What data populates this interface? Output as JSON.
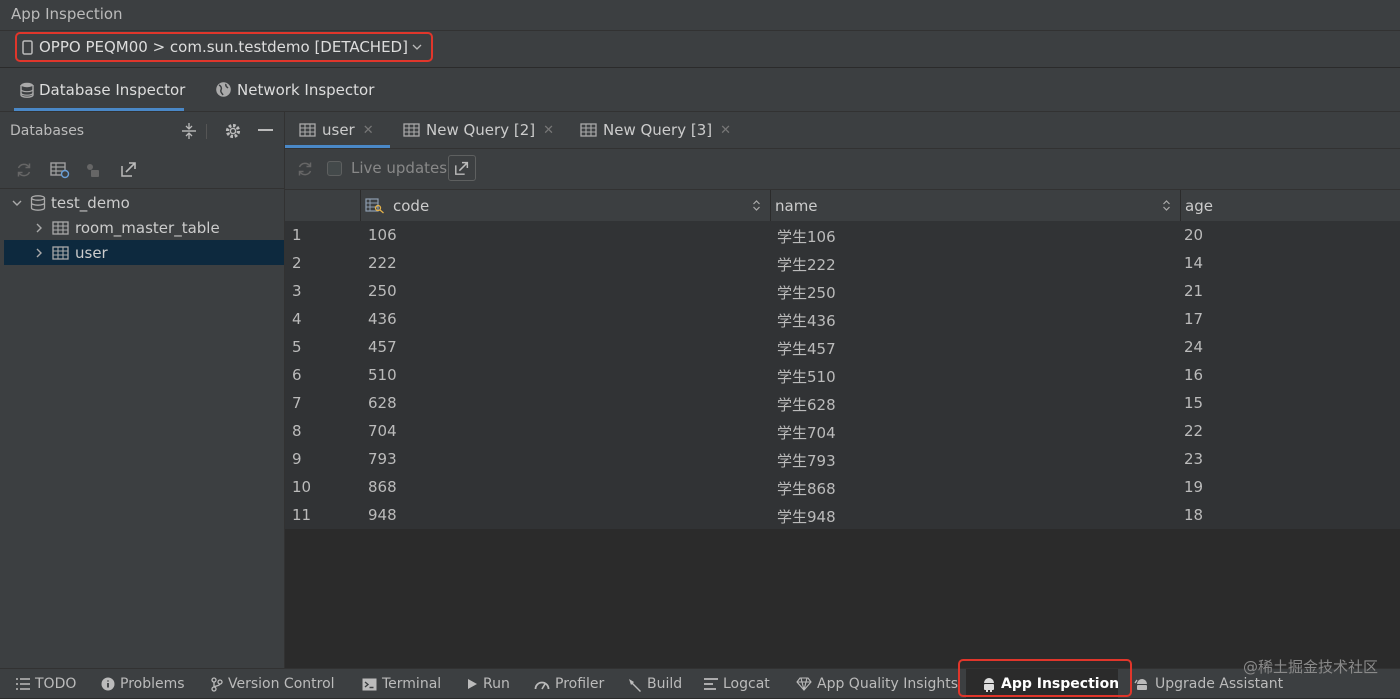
{
  "window": {
    "title": "App Inspection"
  },
  "device": {
    "label": "OPPO PEQM00 > com.sun.testdemo [DETACHED]"
  },
  "inspector_tabs": [
    {
      "label": "Database Inspector",
      "icon": "database-icon",
      "active": true
    },
    {
      "label": "Network Inspector",
      "icon": "globe-icon",
      "active": false
    }
  ],
  "databases_panel": {
    "title": "Databases",
    "tree": [
      {
        "label": "test_demo",
        "icon": "database-icon",
        "expanded": true
      },
      {
        "label": "room_master_table",
        "icon": "table-icon"
      },
      {
        "label": "user",
        "icon": "table-icon",
        "selected": true
      }
    ]
  },
  "query_tabs": [
    {
      "label": "user",
      "active": true
    },
    {
      "label": "New Query [2]",
      "active": false
    },
    {
      "label": "New Query [3]",
      "active": false
    }
  ],
  "toolbar": {
    "live_updates_label": "Live updates",
    "live_updates_checked": false
  },
  "table": {
    "columns": [
      {
        "label": "code",
        "primary_key": true
      },
      {
        "label": "name"
      },
      {
        "label": "age"
      }
    ],
    "rows": [
      {
        "index": "1",
        "code": "106",
        "name": "学生106",
        "age": "20"
      },
      {
        "index": "2",
        "code": "222",
        "name": "学生222",
        "age": "14"
      },
      {
        "index": "3",
        "code": "250",
        "name": "学生250",
        "age": "21"
      },
      {
        "index": "4",
        "code": "436",
        "name": "学生436",
        "age": "17"
      },
      {
        "index": "5",
        "code": "457",
        "name": "学生457",
        "age": "24"
      },
      {
        "index": "6",
        "code": "510",
        "name": "学生510",
        "age": "16"
      },
      {
        "index": "7",
        "code": "628",
        "name": "学生628",
        "age": "15"
      },
      {
        "index": "8",
        "code": "704",
        "name": "学生704",
        "age": "22"
      },
      {
        "index": "9",
        "code": "793",
        "name": "学生793",
        "age": "23"
      },
      {
        "index": "10",
        "code": "868",
        "name": "学生868",
        "age": "19"
      },
      {
        "index": "11",
        "code": "948",
        "name": "学生948",
        "age": "18"
      }
    ]
  },
  "bottom_bar": [
    {
      "label": "TODO",
      "icon": "list-icon"
    },
    {
      "label": "Problems",
      "icon": "info-icon"
    },
    {
      "label": "Version Control",
      "icon": "branch-icon"
    },
    {
      "label": "Terminal",
      "icon": "terminal-icon"
    },
    {
      "label": "Run",
      "icon": "play-icon"
    },
    {
      "label": "Profiler",
      "icon": "gauge-icon"
    },
    {
      "label": "Build",
      "icon": "hammer-icon"
    },
    {
      "label": "Logcat",
      "icon": "logcat-icon"
    },
    {
      "label": "App Quality Insights",
      "icon": "diamond-icon"
    },
    {
      "label": "App Inspection",
      "icon": "android-icon",
      "active": true
    },
    {
      "label": "Upgrade Assistant",
      "icon": "android-upgrade-icon"
    }
  ],
  "watermark": "@稀土掘金技术社区",
  "colors": {
    "highlight_red": "#e0362b",
    "accent_blue": "#4a88c7",
    "selection": "#0d293e"
  }
}
